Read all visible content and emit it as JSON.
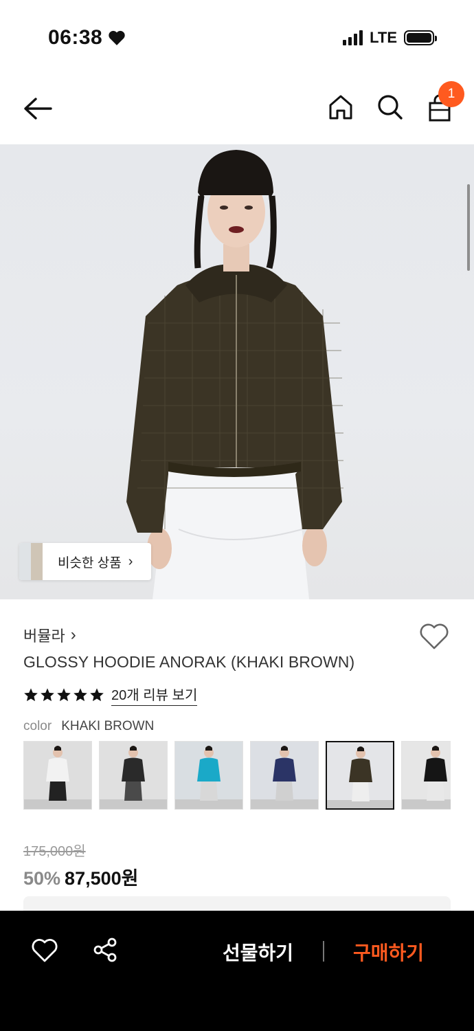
{
  "status_bar": {
    "time": "06:38",
    "network": "LTE"
  },
  "nav": {
    "cart_count": "1"
  },
  "hero": {
    "similar_button_label": "비슷한 상품"
  },
  "product": {
    "brand": "버뮬라",
    "name": "GLOSSY HOODIE ANORAK (KHAKI BROWN)",
    "rating_stars": 5,
    "review_link": "20개 리뷰 보기",
    "color_label": "color",
    "color_value": "KHAKI BROWN",
    "swatches": [
      {
        "jacket_color": "#f2f2f2",
        "bottom_color": "#222222",
        "bg": "#dedede"
      },
      {
        "jacket_color": "#2a2a2a",
        "bottom_color": "#4a4a4a",
        "bg": "#e0e0e0"
      },
      {
        "jacket_color": "#1aa9c8",
        "bottom_color": "#d8d8d8",
        "bg": "#d9dee2"
      },
      {
        "jacket_color": "#2b3466",
        "bottom_color": "#d0d0d0",
        "bg": "#dcdfe4"
      },
      {
        "jacket_color": "#3b3425",
        "bottom_color": "#eeeeee",
        "bg": "#e4e5e8",
        "selected": true
      },
      {
        "jacket_color": "#151515",
        "bottom_color": "#e8e8e8",
        "bg": "#e6e6e6"
      }
    ],
    "original_price": "175,000원",
    "discount": "50%",
    "price": "87,500원"
  },
  "bottom_bar": {
    "gift_label": "선물하기",
    "buy_label": "구매하기"
  },
  "colors": {
    "accent": "#ff5a1f",
    "jacket": "#3b3425"
  }
}
